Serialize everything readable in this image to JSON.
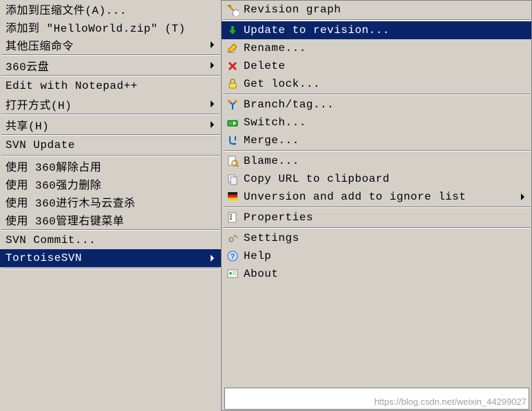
{
  "left_menu": {
    "items": [
      {
        "label": "添加到压缩文件(A)...",
        "arrow": false
      },
      {
        "label": "添加到 \"HelloWorld.zip\" (T)",
        "arrow": false
      },
      {
        "label": "其他压缩命令",
        "arrow": true
      },
      {
        "sep": true
      },
      {
        "label": "360云盘",
        "arrow": true
      },
      {
        "sep": true
      },
      {
        "label": "Edit with Notepad++",
        "arrow": false
      },
      {
        "label": "打开方式(H)",
        "arrow": true
      },
      {
        "sep": true
      },
      {
        "label": "共享(H)",
        "arrow": true
      },
      {
        "sep": true
      },
      {
        "label": "SVN Update",
        "arrow": false
      },
      {
        "sep": true
      },
      {
        "label": "使用 360解除占用",
        "arrow": false
      },
      {
        "label": "使用 360强力删除",
        "arrow": false
      },
      {
        "label": "使用 360进行木马云查杀",
        "arrow": false
      },
      {
        "label": "使用 360管理右键菜单",
        "arrow": false
      },
      {
        "sep": true
      },
      {
        "label": "SVN Commit...",
        "arrow": false
      },
      {
        "label": "TortoiseSVN",
        "arrow": true,
        "highlight": true
      },
      {
        "sep": true
      }
    ]
  },
  "right_menu": {
    "items": [
      {
        "label": "Revision graph",
        "icon": "graph"
      },
      {
        "sep": true
      },
      {
        "label": "Update to revision...",
        "icon": "update",
        "highlight": true
      },
      {
        "label": "Rename...",
        "icon": "rename"
      },
      {
        "label": "Delete",
        "icon": "delete"
      },
      {
        "label": "Get lock...",
        "icon": "lock"
      },
      {
        "sep": true
      },
      {
        "label": "Branch/tag...",
        "icon": "branch"
      },
      {
        "label": "Switch...",
        "icon": "switch"
      },
      {
        "label": "Merge...",
        "icon": "merge"
      },
      {
        "sep": true
      },
      {
        "label": "Blame...",
        "icon": "blame"
      },
      {
        "label": "Copy URL to clipboard",
        "icon": "copy"
      },
      {
        "label": "Unversion and add to ignore list",
        "icon": "unversion",
        "arrow": true
      },
      {
        "sep": true
      },
      {
        "label": "Properties",
        "icon": "properties"
      },
      {
        "sep": true
      },
      {
        "label": "Settings",
        "icon": "settings"
      },
      {
        "label": "Help",
        "icon": "help"
      },
      {
        "label": "About",
        "icon": "about"
      }
    ]
  },
  "watermark": "https://blog.csdn.net/weixin_44299027"
}
